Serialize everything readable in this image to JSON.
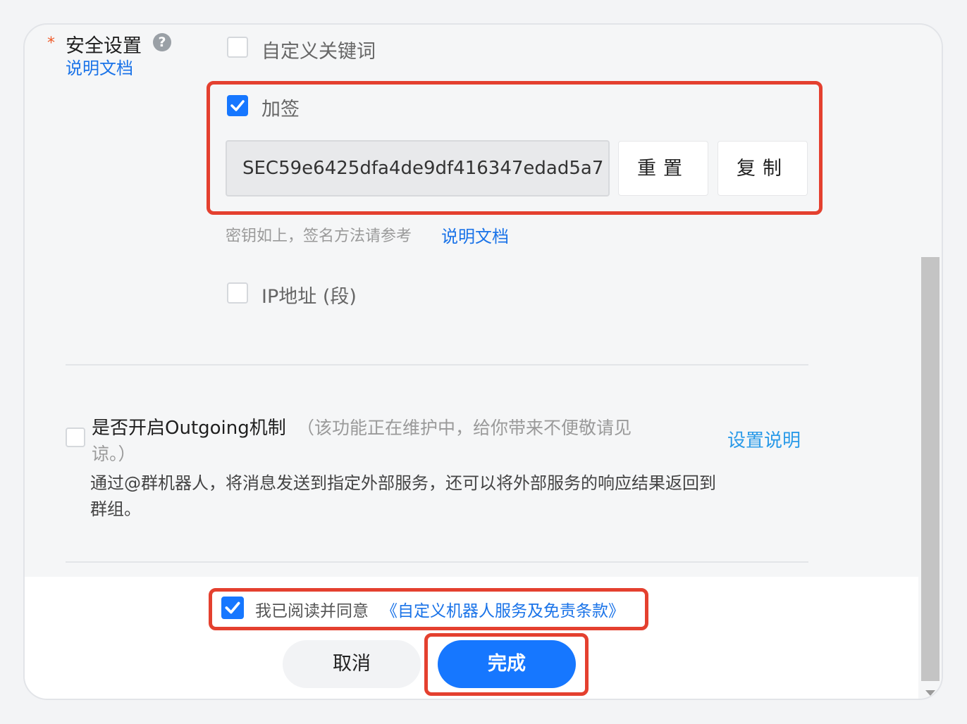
{
  "security": {
    "required_mark": "*",
    "title": "安全设置",
    "help_glyph": "?",
    "doc_link": "说明文档",
    "options": {
      "keyword": {
        "label": "自定义关键词",
        "checked": false
      },
      "sign": {
        "label": "加签",
        "checked": true
      },
      "ip": {
        "label": "IP地址 (段)",
        "checked": false
      }
    },
    "secret_value": "SEC59e6425dfa4de9df416347edad5a7",
    "reset_button": "重置",
    "copy_button": "复制",
    "hint_text": "密钥如上，签名方法请参考",
    "hint_link": "说明文档"
  },
  "outgoing": {
    "checked": false,
    "title": "是否开启Outgoing机制",
    "note_line1": "（该功能正在维护中，给你带来不便敬请见",
    "note_line2": "谅。）",
    "settings_link": "设置说明",
    "description_line1": "通过@群机器人，将消息发送到指定外部服务，还可以将外部服务的响应结果返回到",
    "description_line2": "群组。"
  },
  "agreement": {
    "checked": true,
    "text": "我已阅读并同意",
    "link": "《自定义机器人服务及免责条款》"
  },
  "footer": {
    "cancel_button": "取消",
    "done_button": "完成"
  },
  "colors": {
    "accent": "#1677ff",
    "link": "#1a73e8",
    "annotation_red": "#e4402f"
  }
}
